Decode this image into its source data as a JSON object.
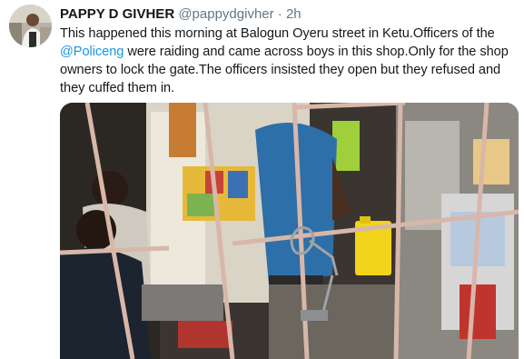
{
  "tweet": {
    "author_name": "PAPPY D GIVHER",
    "author_handle": "@pappydgivher",
    "separator": "·",
    "time": "2h",
    "text_before_mention": "This happened this morning at Balogun Oyeru street in Ketu.Officers of the ",
    "mention": "@Policeng",
    "text_after_mention": " were raiding and came across boys in this shop.Only for the shop owners to lock the gate.The officers insisted they open but they refused and they cuffed them in."
  },
  "media": {
    "type": "photo",
    "description_icon": "photo-icon"
  },
  "colors": {
    "name": "#14171a",
    "meta": "#657786",
    "link": "#1b95e0",
    "text": "#14171a"
  }
}
